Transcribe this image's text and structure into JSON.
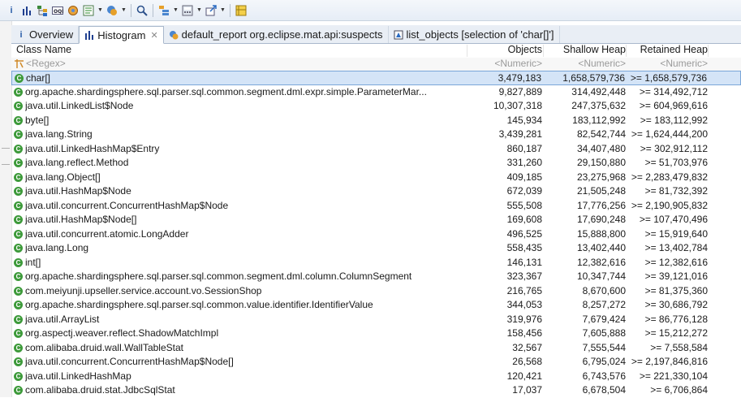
{
  "toolbar": {
    "icons": [
      "info-icon",
      "histogram-icon",
      "dominator-tree-icon",
      "oql-icon",
      "thread-icon",
      "report-icon",
      "caret",
      "heap-dump-overview-icon",
      "caret",
      "search-icon",
      "group-icon",
      "caret",
      "calculator-icon",
      "caret",
      "export-icon",
      "caret",
      "compare-icon"
    ]
  },
  "tabs": [
    {
      "label": "Overview",
      "icon": "i",
      "active": false
    },
    {
      "label": "Histogram",
      "icon": "histogram",
      "active": true,
      "closable": true
    },
    {
      "label": "default_report  org.eclipse.mat.api:suspects",
      "icon": "report",
      "active": false
    },
    {
      "label": "list_objects [selection of 'char[]']",
      "icon": "list",
      "active": false
    }
  ],
  "table": {
    "headers": {
      "name": "Class Name",
      "objects": "Objects",
      "shallow": "Shallow Heap",
      "retained": "Retained Heap"
    },
    "filter": {
      "name": "<Regex>",
      "objects": "<Numeric>",
      "shallow": "<Numeric>",
      "retained": "<Numeric>"
    },
    "rows": [
      {
        "name": "char[]",
        "objects": "3,479,183",
        "shallow": "1,658,579,736",
        "retained": ">= 1,658,579,736",
        "selected": true
      },
      {
        "name": "org.apache.shardingsphere.sql.parser.sql.common.segment.dml.expr.simple.ParameterMar...",
        "objects": "9,827,889",
        "shallow": "314,492,448",
        "retained": ">= 314,492,712"
      },
      {
        "name": "java.util.LinkedList$Node",
        "objects": "10,307,318",
        "shallow": "247,375,632",
        "retained": ">= 604,969,616"
      },
      {
        "name": "byte[]",
        "objects": "145,934",
        "shallow": "183,112,992",
        "retained": ">= 183,112,992"
      },
      {
        "name": "java.lang.String",
        "objects": "3,439,281",
        "shallow": "82,542,744",
        "retained": ">= 1,624,444,200"
      },
      {
        "name": "java.util.LinkedHashMap$Entry",
        "objects": "860,187",
        "shallow": "34,407,480",
        "retained": ">= 302,912,112"
      },
      {
        "name": "java.lang.reflect.Method",
        "objects": "331,260",
        "shallow": "29,150,880",
        "retained": ">= 51,703,976"
      },
      {
        "name": "java.lang.Object[]",
        "objects": "409,185",
        "shallow": "23,275,968",
        "retained": ">= 2,283,479,832"
      },
      {
        "name": "java.util.HashMap$Node",
        "objects": "672,039",
        "shallow": "21,505,248",
        "retained": ">= 81,732,392"
      },
      {
        "name": "java.util.concurrent.ConcurrentHashMap$Node",
        "objects": "555,508",
        "shallow": "17,776,256",
        "retained": ">= 2,190,905,832"
      },
      {
        "name": "java.util.HashMap$Node[]",
        "objects": "169,608",
        "shallow": "17,690,248",
        "retained": ">= 107,470,496"
      },
      {
        "name": "java.util.concurrent.atomic.LongAdder",
        "objects": "496,525",
        "shallow": "15,888,800",
        "retained": ">= 15,919,640"
      },
      {
        "name": "java.lang.Long",
        "objects": "558,435",
        "shallow": "13,402,440",
        "retained": ">= 13,402,784"
      },
      {
        "name": "int[]",
        "objects": "146,131",
        "shallow": "12,382,616",
        "retained": ">= 12,382,616"
      },
      {
        "name": "org.apache.shardingsphere.sql.parser.sql.common.segment.dml.column.ColumnSegment",
        "objects": "323,367",
        "shallow": "10,347,744",
        "retained": ">= 39,121,016"
      },
      {
        "name": "com.meiyunji.upseller.service.account.vo.SessionShop",
        "objects": "216,765",
        "shallow": "8,670,600",
        "retained": ">= 81,375,360"
      },
      {
        "name": "org.apache.shardingsphere.sql.parser.sql.common.value.identifier.IdentifierValue",
        "objects": "344,053",
        "shallow": "8,257,272",
        "retained": ">= 30,686,792"
      },
      {
        "name": "java.util.ArrayList",
        "objects": "319,976",
        "shallow": "7,679,424",
        "retained": ">= 86,776,128"
      },
      {
        "name": "org.aspectj.weaver.reflect.ShadowMatchImpl",
        "objects": "158,456",
        "shallow": "7,605,888",
        "retained": ">= 15,212,272"
      },
      {
        "name": "com.alibaba.druid.wall.WallTableStat",
        "objects": "32,567",
        "shallow": "7,555,544",
        "retained": ">= 7,558,584"
      },
      {
        "name": "java.util.concurrent.ConcurrentHashMap$Node[]",
        "objects": "26,568",
        "shallow": "6,795,024",
        "retained": ">= 2,197,846,816"
      },
      {
        "name": "java.util.LinkedHashMap",
        "objects": "120,421",
        "shallow": "6,743,576",
        "retained": ">= 221,330,104"
      },
      {
        "name": "com.alibaba.druid.stat.JdbcSqlStat",
        "objects": "17,037",
        "shallow": "6,678,504",
        "retained": ">= 6,706,864"
      }
    ]
  }
}
